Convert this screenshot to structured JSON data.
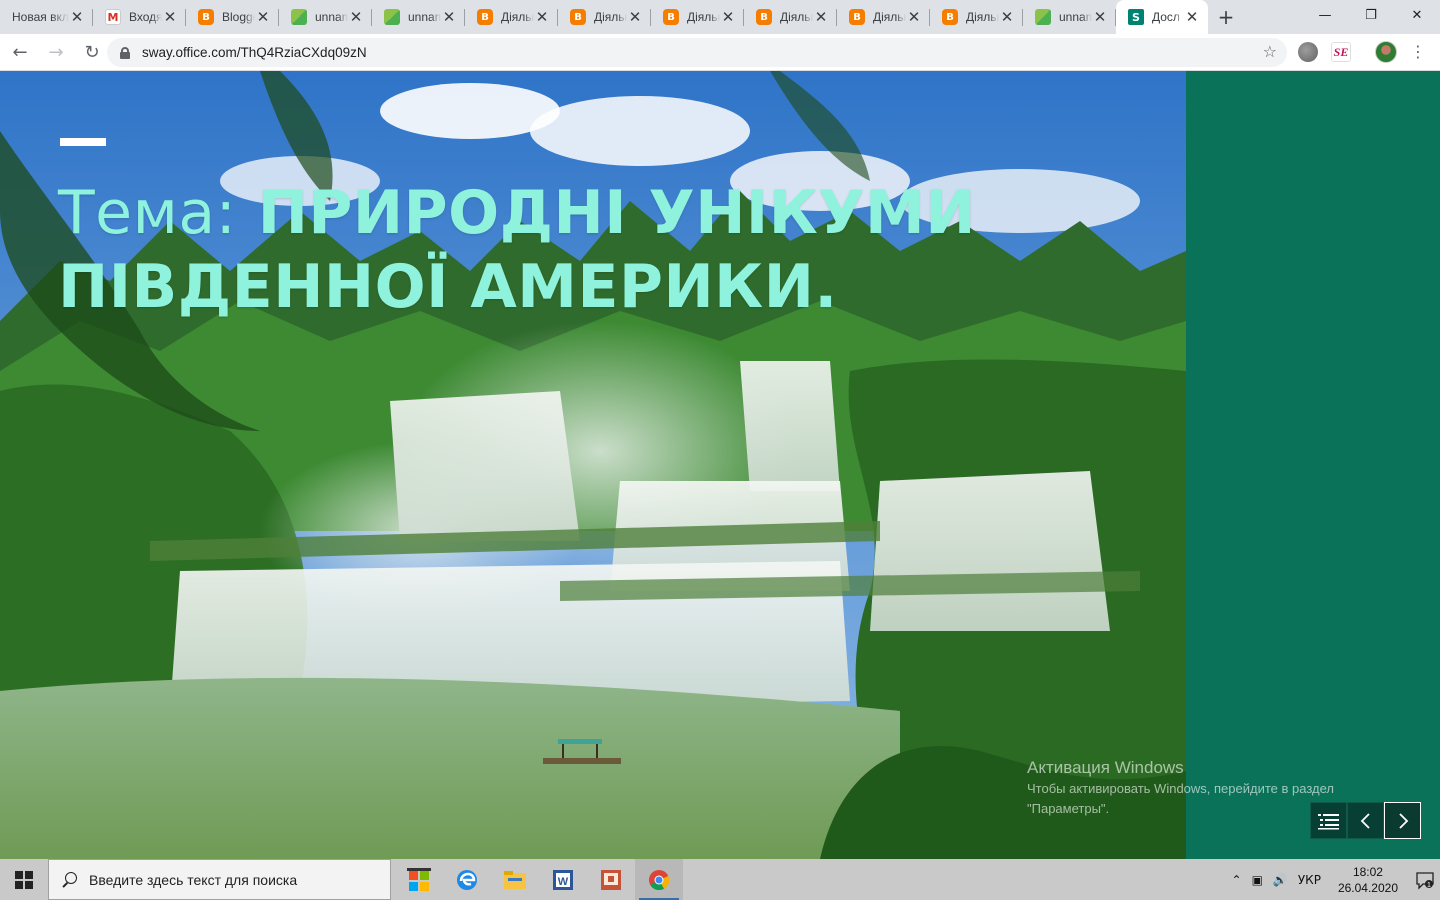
{
  "browser": {
    "tabs": [
      {
        "title": "Новая вкладка",
        "favicon": "none",
        "active": false
      },
      {
        "title": "Входящие",
        "favicon": "gmail",
        "active": false
      },
      {
        "title": "Blogger",
        "favicon": "blogger",
        "active": false
      },
      {
        "title": "unnamed",
        "favicon": "unnamed",
        "active": false
      },
      {
        "title": "unnamed",
        "favicon": "unnamed",
        "active": false
      },
      {
        "title": "Діяльність",
        "favicon": "blogger",
        "active": false
      },
      {
        "title": "Діяльність",
        "favicon": "blogger",
        "active": false
      },
      {
        "title": "Діяльність",
        "favicon": "blogger",
        "active": false
      },
      {
        "title": "Діяльність",
        "favicon": "blogger",
        "active": false
      },
      {
        "title": "Діяльність",
        "favicon": "blogger",
        "active": false
      },
      {
        "title": "Діяльність",
        "favicon": "blogger",
        "active": false
      },
      {
        "title": "unnamed",
        "favicon": "unnamed",
        "active": false
      },
      {
        "title": "Досл",
        "favicon": "sway",
        "active": true
      }
    ],
    "url": "sway.office.com/ThQ4RziaCXdq09zN"
  },
  "sway": {
    "title_label": "Тема:",
    "title_text": "ПРИРОДНІ УНІКУМИ ПІВДЕННОЇ АМЕРИКИ.",
    "accent_color": "#8ff2dd",
    "panel_color": "#0a7259"
  },
  "watermark": {
    "title": "Активация Windows",
    "line1": "Чтобы активировать Windows, перейдите в раздел",
    "line2": "\"Параметры\"."
  },
  "taskbar": {
    "search_placeholder": "Введите здесь текст для поиска",
    "apps": [
      "store-icon",
      "edge-icon",
      "file-explorer-icon",
      "word-icon",
      "presentation-icon",
      "chrome-icon"
    ],
    "language": "УКР",
    "time": "18:02",
    "date": "26.04.2020",
    "notification_count": "1"
  }
}
